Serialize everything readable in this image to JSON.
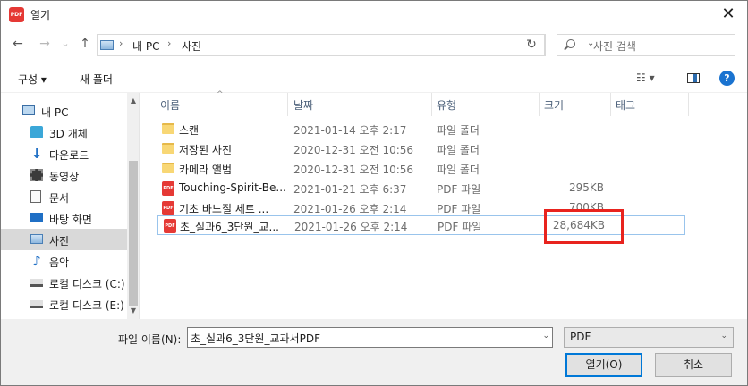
{
  "window": {
    "title": "열기",
    "app_icon_text": "PDF",
    "close_glyph": "✕"
  },
  "nav": {
    "back": "←",
    "forward": "→",
    "recent": "⌄",
    "up": "↑",
    "breadcrumb": [
      "내 PC",
      "사진"
    ],
    "sep": "›",
    "address_dropdown": "⌄",
    "refresh": "↻",
    "search_placeholder": "사진 검색"
  },
  "toolbar": {
    "organize": "구성 ▾",
    "new_folder": "새 폴더",
    "view": "☷ ▾",
    "help": "?"
  },
  "sidebar": {
    "items": [
      {
        "label": "내 PC",
        "icon": "pc-icon"
      },
      {
        "label": "3D 개체",
        "icon": "cube-icon"
      },
      {
        "label": "다운로드",
        "icon": "download-icon"
      },
      {
        "label": "동영상",
        "icon": "video-icon"
      },
      {
        "label": "문서",
        "icon": "document-icon"
      },
      {
        "label": "바탕 화면",
        "icon": "desktop-icon"
      },
      {
        "label": "사진",
        "icon": "pictures-icon",
        "selected": true
      },
      {
        "label": "음악",
        "icon": "music-icon"
      },
      {
        "label": "로컬 디스크 (C:)",
        "icon": "drive-icon"
      },
      {
        "label": "로컬 디스크 (E:)",
        "icon": "drive-icon"
      }
    ],
    "scroll_up": "▲",
    "scroll_down": "▼"
  },
  "files": {
    "columns": [
      "이름",
      "날짜",
      "유형",
      "크기",
      "태그"
    ],
    "sort_caret": "^",
    "rows": [
      {
        "name": "스캔",
        "date": "2021-01-14 오후 2:17",
        "type": "파일 폴더",
        "size": "",
        "kind": "folder"
      },
      {
        "name": "저장된 사진",
        "date": "2020-12-31 오전 10:56",
        "type": "파일 폴더",
        "size": "",
        "kind": "folder"
      },
      {
        "name": "카메라 앨범",
        "date": "2020-12-31 오전 10:56",
        "type": "파일 폴더",
        "size": "",
        "kind": "folder"
      },
      {
        "name": "Touching-Spirit-Be...",
        "date": "2021-01-21 오후 6:37",
        "type": "PDF 파일",
        "size": "295KB",
        "kind": "pdf"
      },
      {
        "name": "기초 바느질 세트 ...",
        "date": "2021-01-26 오후 2:14",
        "type": "PDF 파일",
        "size": "700KB",
        "kind": "pdf"
      },
      {
        "name": "초_실과6_3단원_교...",
        "date": "2021-01-26 오후 2:14",
        "type": "PDF 파일",
        "size": "28,684KB",
        "kind": "pdf",
        "focused": true
      }
    ]
  },
  "bottom": {
    "filename_label": "파일 이름(N):",
    "filename_value": "초_실과6_3단원_교과서PDF",
    "filter_value": "PDF",
    "dropdown_glyph": "⌄",
    "open_label": "열기(O)",
    "cancel_label": "취소"
  },
  "colors": {
    "highlight": "#e8231e",
    "accent": "#0078d7",
    "pdf": "#e53935",
    "folder": "#f8d775"
  }
}
